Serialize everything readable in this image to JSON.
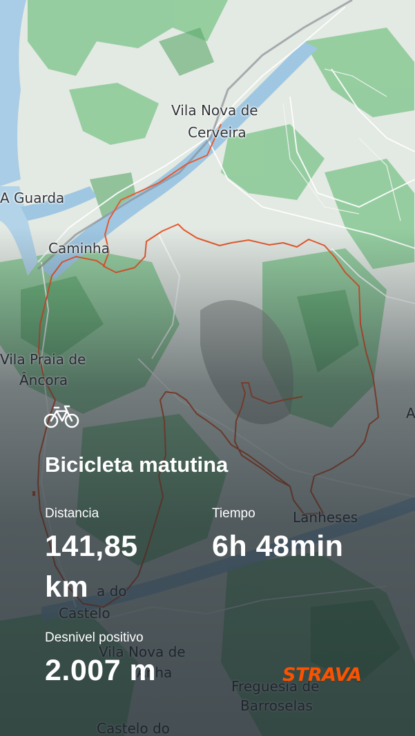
{
  "map": {
    "places": [
      {
        "name": "Vila Nova de"
      },
      {
        "name": "Cerveira"
      },
      {
        "name": "A Guarda"
      },
      {
        "name": "Caminha"
      },
      {
        "name": "Vila Praia de"
      },
      {
        "name": "Âncora"
      },
      {
        "name": "A"
      },
      {
        "name": "Lanheses"
      },
      {
        "name": "a do"
      },
      {
        "name": "Castelo"
      },
      {
        "name": "Vila Nova de"
      },
      {
        "name": "Anha"
      },
      {
        "name": "Freguesia de"
      },
      {
        "name": "Barroselas"
      },
      {
        "name": "Castelo do"
      }
    ],
    "colors": {
      "route": "#e8582d",
      "water": "#a9cde6",
      "forest": "#6fbd7e",
      "land": "#e6ebe6",
      "road": "#ffffff"
    }
  },
  "activity": {
    "icon": "bicycle-icon",
    "title": "Bicicleta matutina",
    "distance": {
      "label": "Distancia",
      "value": "141,85",
      "unit": "km"
    },
    "time": {
      "label": "Tiempo",
      "value": "6h 48min"
    },
    "elevation": {
      "label": "Desnivel positivo",
      "value": "2.007 m"
    }
  },
  "brand": {
    "logo": "STRAVA",
    "color": "#fc5200"
  }
}
